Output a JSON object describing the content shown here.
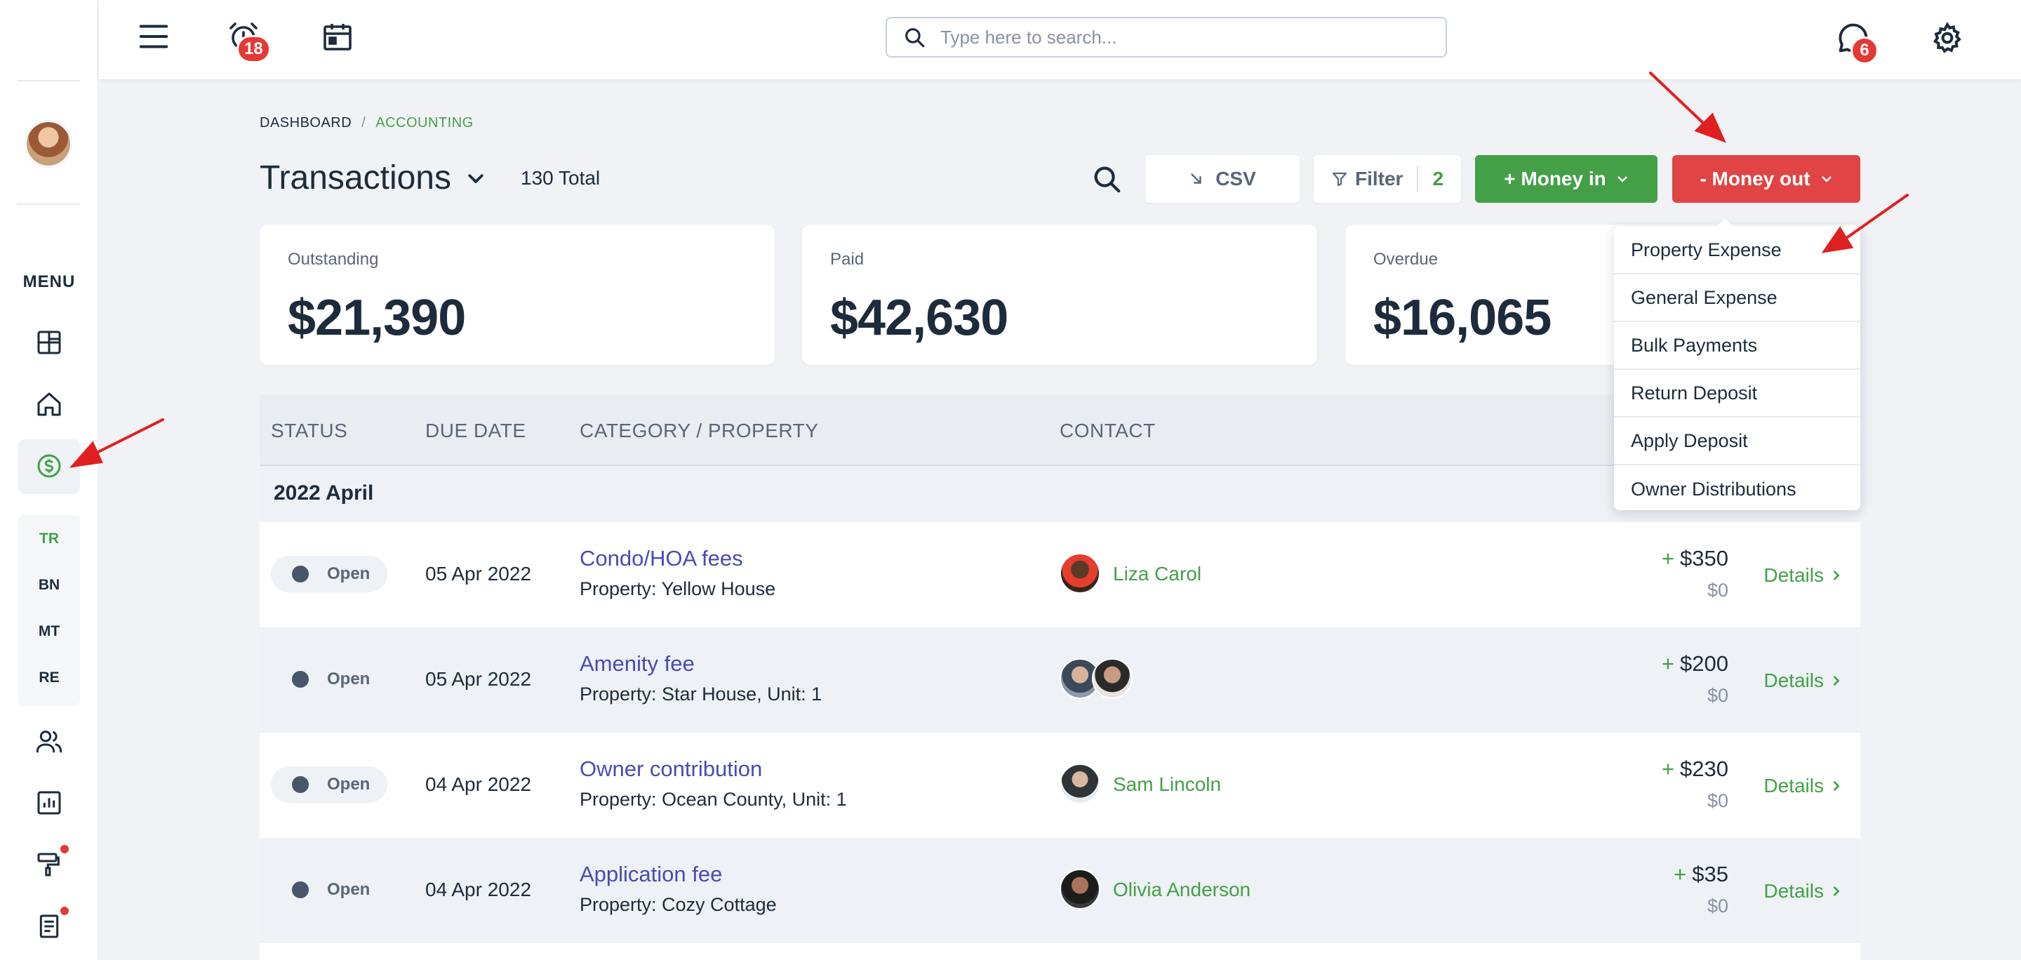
{
  "topbar": {
    "menu_icon": "hamburger-menu-icon",
    "alarm_badge": "18",
    "chat_badge": "6",
    "search_placeholder": "Type here to search..."
  },
  "sidebar": {
    "menu_label": "MENU",
    "sub_items": [
      "TR",
      "BN",
      "MT",
      "RE"
    ],
    "active_sub": "TR",
    "icons": [
      "grid-icon",
      "home-icon",
      "dollar-circle-icon",
      "users-icon",
      "chart-icon",
      "paint-roller-icon",
      "document-icon"
    ]
  },
  "breadcrumb": {
    "dashboard": "DASHBOARD",
    "separator": "/",
    "current": "ACCOUNTING"
  },
  "header": {
    "title": "Transactions",
    "total": "130 Total",
    "csv_label": "CSV",
    "filter_label": "Filter",
    "filter_count": "2",
    "money_in_label": "+ Money in",
    "money_out_label": "- Money out"
  },
  "cards": [
    {
      "label": "Outstanding",
      "value": "$21,390"
    },
    {
      "label": "Paid",
      "value": "$42,630"
    },
    {
      "label": "Overdue",
      "value": "$16,065"
    }
  ],
  "table": {
    "columns": [
      "STATUS",
      "DUE DATE",
      "CATEGORY / PROPERTY",
      "CONTACT"
    ],
    "group": "2022 April",
    "rows": [
      {
        "status": "Open",
        "due": "05 Apr 2022",
        "category": "Condo/HOA fees",
        "property": "Property: Yellow House",
        "contact": "Liza Carol",
        "amount": "$350",
        "sub": "$0",
        "details": "Details"
      },
      {
        "status": "Open",
        "due": "05 Apr 2022",
        "category": "Amenity fee",
        "property": "Property: Star House, Unit: 1",
        "contact": "",
        "amount": "$200",
        "sub": "$0",
        "details": "Details"
      },
      {
        "status": "Open",
        "due": "04 Apr 2022",
        "category": "Owner contribution",
        "property": "Property: Ocean County, Unit: 1",
        "contact": "Sam Lincoln",
        "amount": "$230",
        "sub": "$0",
        "details": "Details"
      },
      {
        "status": "Open",
        "due": "04 Apr 2022",
        "category": "Application fee",
        "property": "Property: Cozy Cottage",
        "contact": "Olivia Anderson",
        "amount": "$35",
        "sub": "$0",
        "details": "Details"
      }
    ]
  },
  "money_out_menu": [
    "Property Expense",
    "General Expense",
    "Bulk Payments",
    "Return Deposit",
    "Apply Deposit",
    "Owner Distributions"
  ],
  "colors": {
    "accent_green": "#43a047",
    "danger_red": "#e04444",
    "link_purple": "#4a4bb0",
    "annotation_arrow": "#e02020"
  }
}
